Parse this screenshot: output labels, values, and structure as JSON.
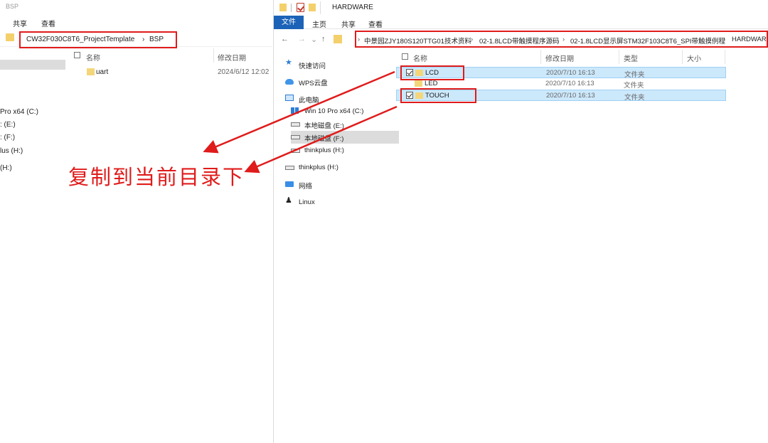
{
  "left_window": {
    "title": "BSP",
    "ribbon_tabs": [
      "共享",
      "查看"
    ],
    "path": {
      "segments": [
        "CW32F030C8T6_ProjectTemplate",
        "BSP"
      ],
      "separator": "›"
    },
    "columns": {
      "name": "名称",
      "date": "修改日期"
    },
    "files": [
      {
        "name": "uart",
        "date": "2024/6/12 12:02"
      }
    ],
    "nav_items": [
      "Pro x64 (C:)",
      ": (E:)",
      ": (F:)",
      "lus (H:)",
      "(H:)"
    ]
  },
  "right_window": {
    "title": "HARDWARE",
    "ribbon_tabs": {
      "file": "文件",
      "home": "主页",
      "share": "共享",
      "view": "查看"
    },
    "nav_buttons": {
      "back": "←",
      "forward": "→",
      "recent": "⌄",
      "up": "↑"
    },
    "path": {
      "segments": [
        "中景园ZJY180S120TTG01技术资料",
        "02-1.8LCD带触摸程序源码",
        "02-1.8LCD显示屏STM32F103C8T6_SPI带触摸例程",
        "HARDWARE"
      ],
      "separator": "›"
    },
    "nav_pane": [
      {
        "label": "快速访问",
        "icon": "star-icon"
      },
      {
        "label": "WPS云盘",
        "icon": "cloud-icon"
      },
      {
        "label": "此电脑",
        "icon": "pc-icon"
      },
      {
        "label": "Win 10 Pro x64 (C:)",
        "icon": "windows-drive-icon"
      },
      {
        "label": "本地磁盘 (E:)",
        "icon": "drive-icon"
      },
      {
        "label": "本地磁盘 (F:)",
        "icon": "drive-icon",
        "selected": true
      },
      {
        "label": "thinkplus (H:)",
        "icon": "drive-icon"
      },
      {
        "label": "thinkplus (H:)",
        "icon": "drive-icon"
      },
      {
        "label": "网络",
        "icon": "network-icon"
      },
      {
        "label": "Linux",
        "icon": "penguin-icon"
      }
    ],
    "columns": {
      "name": "名称",
      "date": "修改日期",
      "type": "类型",
      "size": "大小"
    },
    "files": [
      {
        "name": "LCD",
        "date": "2020/7/10 16:13",
        "type": "文件夹",
        "checked": true,
        "selected": true
      },
      {
        "name": "LED",
        "date": "2020/7/10 16:13",
        "type": "文件夹",
        "checked": false,
        "selected": false
      },
      {
        "name": "TOUCH",
        "date": "2020/7/10 16:13",
        "type": "文件夹",
        "checked": true,
        "selected": true
      }
    ]
  },
  "annotation": {
    "text": "复制到当前目录下",
    "color": "#e01b1b"
  },
  "colors": {
    "highlight_red": "#e01b1b",
    "file_tab_blue": "#1c63b8",
    "selection_blue": "#cce8fb",
    "folder_yellow": "#f4d67a"
  }
}
